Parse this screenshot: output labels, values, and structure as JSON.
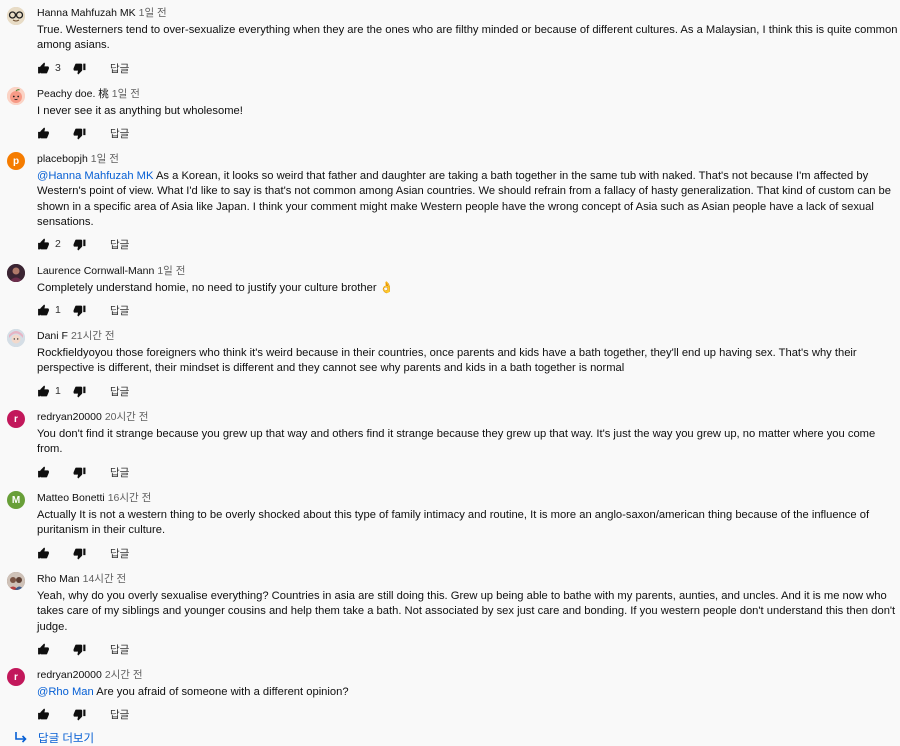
{
  "comments": [
    {
      "author": "Hanna Mahfuzah MK",
      "time": "1일 전",
      "mention": "",
      "text": "True. Westerners tend to over-sexualize everything when they are the ones who are filthy minded or because of different cultures. As a Malaysian, I think this is quite common among asians.",
      "likes": "3",
      "reply_label": "답글",
      "avatar": "cartoon-glasses-avatar",
      "avatar_color": "#c9b89a"
    },
    {
      "author": "Peachy doe. 桃",
      "time": "1일 전",
      "mention": "",
      "text": "I never see it as anything but wholesome!",
      "likes": "",
      "reply_label": "답글",
      "avatar": "peach-face-avatar",
      "avatar_color": "#f4b6a5"
    },
    {
      "author": "placebopjh",
      "time": "1일 전",
      "mention": "@Hanna Mahfuzah MK",
      "text": " As a Korean, it looks so weird that father and daughter are taking a bath together in the same tub with naked. That's not because I'm affected by Western's point of view. What I'd like to say is that's not common among Asian countries. We should refrain from a fallacy of hasty  generalization. That kind of custom can be shown in a specific area of Asia like Japan. I think your comment might make Western people have the wrong concept of Asia such as Asian people have a lack of sexual sensations.",
      "likes": "2",
      "reply_label": "답글",
      "avatar": "letter-avatar",
      "avatar_letter": "p",
      "avatar_color": "#f57c00"
    },
    {
      "author": "Laurence Cornwall-Mann",
      "time": "1일 전",
      "mention": "",
      "text": "Completely understand homie, no need to justify your culture brother 👌",
      "likes": "1",
      "reply_label": "답글",
      "avatar": "photo-avatar",
      "avatar_color": "#5a3a4a"
    },
    {
      "author": "Dani F",
      "time": "21시간 전",
      "mention": "",
      "text": "Rockfieldyoyou those foreigners who think it's weird because in their countries, once parents and kids have a bath together, they'll end up having sex. That's why their perspective is different, their mindset is different and they cannot see why parents and kids in a bath together is normal",
      "likes": "1",
      "reply_label": "답글",
      "avatar": "anime-avatar",
      "avatar_color": "#b8c4cc"
    },
    {
      "author": "redryan20000",
      "time": "20시간 전",
      "mention": "",
      "text": "You don't find it strange because you grew up that way and others find it strange because they grew up that way. It's just the way you grew up, no matter where you come from.",
      "likes": "",
      "reply_label": "답글",
      "avatar": "letter-avatar",
      "avatar_letter": "r",
      "avatar_color": "#c2185b"
    },
    {
      "author": "Matteo Bonetti",
      "time": "16시간 전",
      "mention": "",
      "text": "Actually It is not a western thing to be overly shocked about this type of family intimacy and routine, It is more an anglo-saxon/american thing because of the influence of puritanism in their culture.",
      "likes": "",
      "reply_label": "답글",
      "avatar": "letter-avatar",
      "avatar_letter": "M",
      "avatar_color": "#689f38"
    },
    {
      "author": "Rho Man",
      "time": "14시간 전",
      "mention": "",
      "text": "Yeah, why do you overly sexualise everything? Countries in asia are still doing this. Grew up being able to bathe with my parents, aunties, and uncles. And it is me now who takes care of my siblings and younger cousins and help them take a bath. Not associated by sex just care and bonding. If you western people don't understand this then don't judge.",
      "likes": "",
      "reply_label": "답글",
      "avatar": "photo-avatar",
      "avatar_color": "#8d6e63"
    },
    {
      "author": "redryan20000",
      "time": "2시간 전",
      "mention": "@Rho Man",
      "text": " Are you afraid of someone with a different opinion?",
      "likes": "",
      "reply_label": "답글",
      "avatar": "letter-avatar",
      "avatar_letter": "r",
      "avatar_color": "#c2185b"
    }
  ],
  "more_replies_label": "답글 더보기",
  "colors": {
    "link": "#065fd4",
    "background": "#f9f9f9"
  },
  "icons": [
    "thumbs-up-icon",
    "thumbs-down-icon",
    "reply-arrow-icon"
  ]
}
